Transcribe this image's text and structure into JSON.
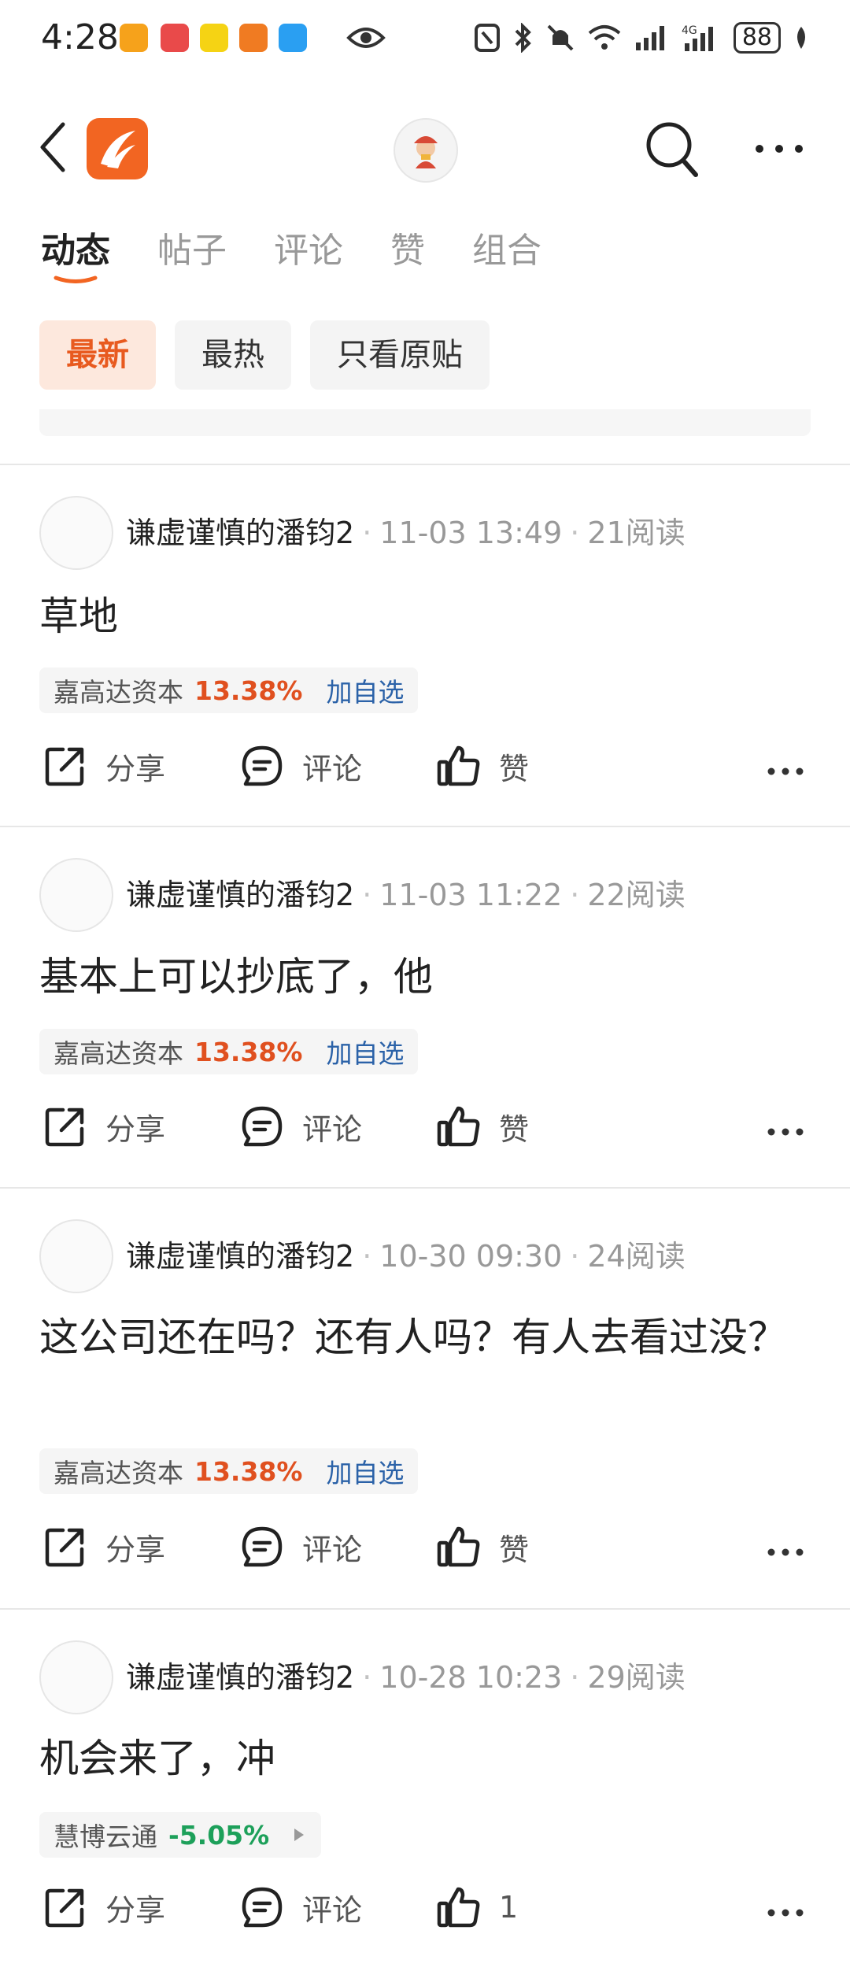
{
  "status_bar": {
    "time": "4:28",
    "battery": "88",
    "app_icon_colors": [
      "#f6a21b",
      "#e94a4a",
      "#f5d314",
      "#f07b22",
      "#2a9ff2"
    ]
  },
  "header": {
    "icons": [
      "back-icon",
      "app-logo",
      "avatar",
      "search-icon",
      "more-icon"
    ]
  },
  "tabs": [
    {
      "label": "动态",
      "active": true
    },
    {
      "label": "帖子",
      "active": false
    },
    {
      "label": "评论",
      "active": false
    },
    {
      "label": "赞",
      "active": false
    },
    {
      "label": "组合",
      "active": false
    }
  ],
  "filters": [
    {
      "label": "最新",
      "active": true
    },
    {
      "label": "最热",
      "active": false
    },
    {
      "label": "只看原贴",
      "active": false
    }
  ],
  "posts": [
    {
      "author": "谦虚谨慎的潘钧2",
      "date": "11-03 13:49",
      "reads": "21阅读",
      "text": "草地",
      "stock": {
        "name": "嘉高达资本",
        "change": "13.38%",
        "add": "加自选"
      },
      "actions": {
        "share": "分享",
        "comment": "评论",
        "like": "赞"
      }
    },
    {
      "author": "谦虚谨慎的潘钧2",
      "date": "11-03 11:22",
      "reads": "22阅读",
      "text": "基本上可以抄底了，他",
      "stock": {
        "name": "嘉高达资本",
        "change": "13.38%",
        "add": "加自选"
      },
      "actions": {
        "share": "分享",
        "comment": "评论",
        "like": "赞"
      }
    },
    {
      "author": "谦虚谨慎的潘钧2",
      "date": "10-30 09:30",
      "reads": "24阅读",
      "text": "这公司还在吗？还有人吗？有人去看过没？",
      "stock": {
        "name": "嘉高达资本",
        "change": "13.38%",
        "add": "加自选"
      },
      "actions": {
        "share": "分享",
        "comment": "评论",
        "like": "赞"
      }
    },
    {
      "author": "谦虚谨慎的潘钧2",
      "date": "10-28 10:23",
      "reads": "29阅读",
      "text": "机会来了，冲",
      "stock": {
        "name": "慧博云通",
        "change": "-5.05%",
        "add": ""
      },
      "actions": {
        "share": "分享",
        "comment": "评论",
        "like": "1"
      }
    }
  ]
}
